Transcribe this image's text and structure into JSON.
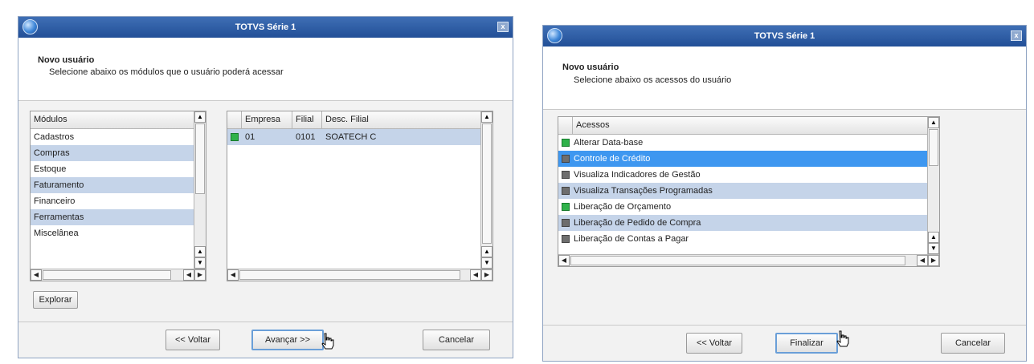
{
  "window_left": {
    "title": "TOTVS Série 1",
    "close_label": "x",
    "heading": "Novo usuário",
    "subheading": "Selecione abaixo os módulos que o usuário poderá acessar",
    "modules": {
      "header": "Módulos",
      "items": [
        {
          "label": "Cadastros",
          "highlighted": false
        },
        {
          "label": "Compras",
          "highlighted": true
        },
        {
          "label": "Estoque",
          "highlighted": false
        },
        {
          "label": "Faturamento",
          "highlighted": true
        },
        {
          "label": "Financeiro",
          "highlighted": false
        },
        {
          "label": "Ferramentas",
          "highlighted": true
        },
        {
          "label": "Miscelânea",
          "highlighted": false
        }
      ]
    },
    "branches": {
      "columns": [
        "Empresa",
        "Filial",
        "Desc. Filial"
      ],
      "rows": [
        {
          "empresa": "01",
          "filial": "0101",
          "desc": "SOATECH C",
          "status_color": "#2fb24a"
        }
      ]
    },
    "explore_label": "Explorar",
    "back_label": "<< Voltar",
    "next_label": "Avançar >>",
    "cancel_label": "Cancelar"
  },
  "window_right": {
    "title": "TOTVS Série 1",
    "close_label": "x",
    "heading": "Novo usuário",
    "subheading": "Selecione abaixo os acessos do usuário",
    "access": {
      "header": "Acessos",
      "items": [
        {
          "label": "Alterar Data-base",
          "enabled": true,
          "state": "normal"
        },
        {
          "label": "Controle de Crédito",
          "enabled": false,
          "state": "selected"
        },
        {
          "label": "Visualiza Indicadores de Gestão",
          "enabled": false,
          "state": "normal"
        },
        {
          "label": "Visualiza Transações Programadas",
          "enabled": false,
          "state": "alt"
        },
        {
          "label": "Liberação de Orçamento",
          "enabled": true,
          "state": "normal"
        },
        {
          "label": "Liberação de Pedido de Compra",
          "enabled": false,
          "state": "alt"
        },
        {
          "label": "Liberação de Contas a Pagar",
          "enabled": false,
          "state": "normal"
        }
      ]
    },
    "back_label": "<< Voltar",
    "finish_label": "Finalizar",
    "cancel_label": "Cancelar"
  },
  "colors": {
    "titlebar": "#2a5aa3",
    "row_highlight": "#c5d4e9",
    "row_selected": "#3e97f0",
    "status_on": "#2fb24a",
    "status_off": "#6e6e6e"
  }
}
